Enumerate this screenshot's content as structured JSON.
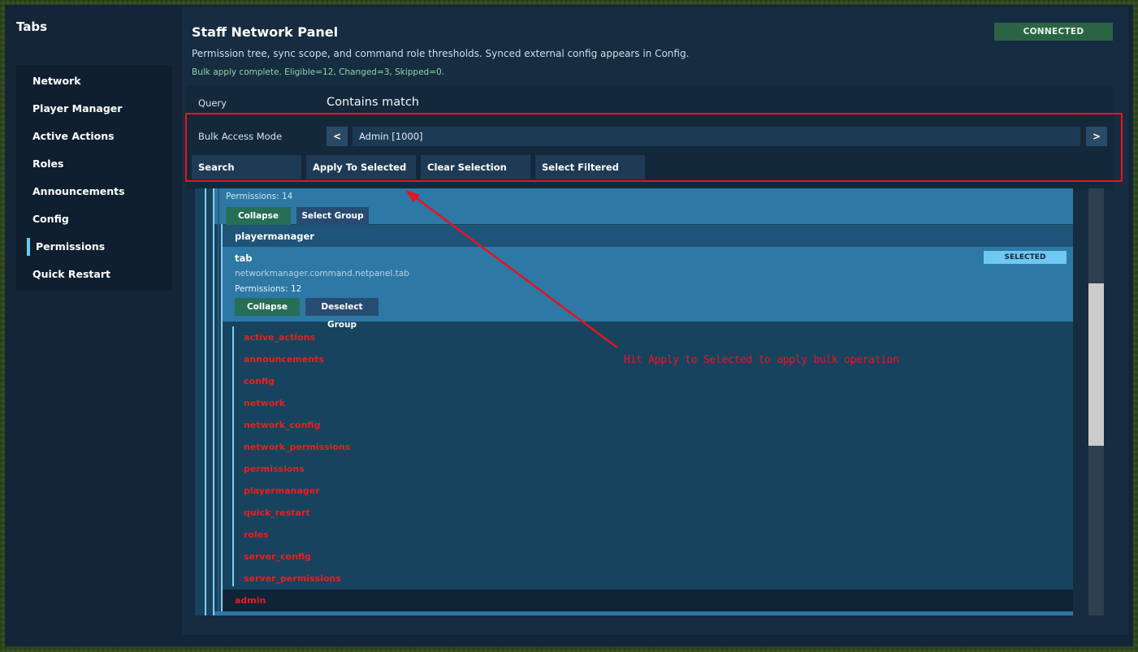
{
  "sidebar": {
    "title": "Tabs",
    "items": [
      {
        "label": "Network"
      },
      {
        "label": "Player Manager"
      },
      {
        "label": "Active Actions"
      },
      {
        "label": "Roles"
      },
      {
        "label": "Announcements"
      },
      {
        "label": "Config"
      },
      {
        "label": "Permissions"
      },
      {
        "label": "Quick Restart"
      }
    ],
    "active_index": 6
  },
  "panel": {
    "title": "Staff Network Panel",
    "subtitle": "Permission tree, sync scope, and command role thresholds. Synced external config appears in Config.",
    "status_message": "Bulk apply complete. Eligible=12, Changed=3, Skipped=0.",
    "connection_badge": "CONNECTED"
  },
  "query": {
    "label": "Query",
    "value": "Contains match"
  },
  "bulk": {
    "label": "Bulk Access Mode",
    "prev": "<",
    "next": ">",
    "selected_mode": "Admin [1000]"
  },
  "actions": {
    "search": "Search",
    "apply_to_selected": "Apply To Selected",
    "clear_selection": "Clear Selection",
    "select_filtered": "Select Filtered"
  },
  "tree": {
    "top_group": {
      "permissions_count": "Permissions: 14",
      "collapse": "Collapse",
      "select_group": "Select Group"
    },
    "playermanager_row": "playermanager",
    "tab_group": {
      "name": "tab",
      "badge": "SELECTED",
      "node": "networkmanager.command.netpanel.tab",
      "permissions_count": "Permissions: 12",
      "collapse": "Collapse",
      "deselect_group": "Deselect Group"
    },
    "permissions": [
      "active_actions",
      "announcements",
      "config",
      "network",
      "network_config",
      "network_permissions",
      "permissions",
      "playermanager",
      "quick_restart",
      "roles",
      "server_config",
      "server_permissions"
    ],
    "admin_row": "admin"
  },
  "annotation": {
    "text": "Hit Apply to Selected to apply bulk operation",
    "color": "#e8141e"
  },
  "colors": {
    "accent": "#6ec8ef",
    "connected_bg": "#2b6444",
    "permission_text": "#ee1c1c"
  }
}
